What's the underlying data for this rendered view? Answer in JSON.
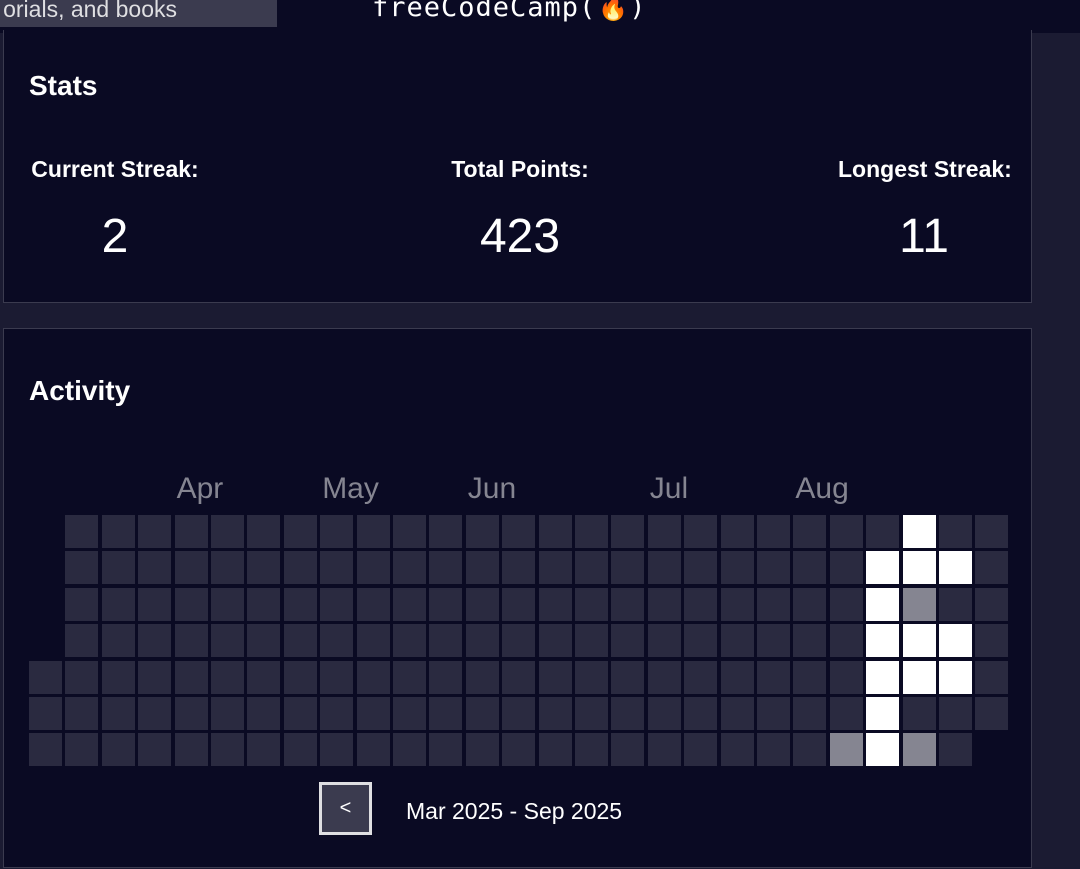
{
  "search": {
    "placeholder_visible": "orials, and books"
  },
  "logo": {
    "text": "freeCodeCamp"
  },
  "stats": {
    "title": "Stats",
    "current_streak_label": "Current Streak:",
    "current_streak_value": "2",
    "total_points_label": "Total Points:",
    "total_points_value": "423",
    "longest_streak_label": "Longest Streak:",
    "longest_streak_value": "11"
  },
  "activity": {
    "title": "Activity",
    "months": [
      "Apr",
      "May",
      "Jun",
      "Jul",
      "Aug"
    ],
    "month_week_index": [
      4,
      8,
      12,
      17,
      21
    ],
    "weeks": 27,
    "days_per_week": 7,
    "first_week_start_day": 4,
    "last_week_end_day": 5,
    "active_cells": [
      {
        "week": 23,
        "day": 1,
        "level": "high"
      },
      {
        "week": 23,
        "day": 2,
        "level": "high"
      },
      {
        "week": 23,
        "day": 3,
        "level": "high"
      },
      {
        "week": 23,
        "day": 4,
        "level": "high"
      },
      {
        "week": 23,
        "day": 5,
        "level": "high"
      },
      {
        "week": 23,
        "day": 6,
        "level": "high"
      },
      {
        "week": 24,
        "day": 0,
        "level": "high"
      },
      {
        "week": 24,
        "day": 1,
        "level": "high"
      },
      {
        "week": 24,
        "day": 2,
        "level": "medium"
      },
      {
        "week": 24,
        "day": 3,
        "level": "high"
      },
      {
        "week": 24,
        "day": 4,
        "level": "high"
      },
      {
        "week": 24,
        "day": 6,
        "level": "medium"
      },
      {
        "week": 25,
        "day": 1,
        "level": "high"
      },
      {
        "week": 25,
        "day": 3,
        "level": "high"
      },
      {
        "week": 25,
        "day": 4,
        "level": "high"
      },
      {
        "week": 22,
        "day": 6,
        "level": "medium"
      }
    ],
    "colors": {
      "empty": "#2a2a40",
      "medium": "#858591",
      "high": "#ffffff"
    },
    "prev_button_label": "<",
    "range_label": "Mar 2025 - Sep 2025"
  }
}
